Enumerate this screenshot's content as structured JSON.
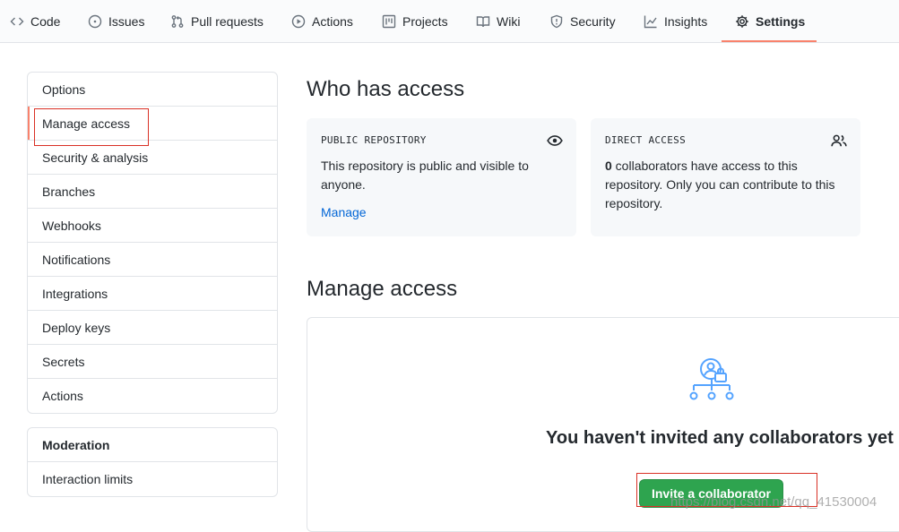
{
  "repo_nav": {
    "tabs": [
      {
        "label": "Code",
        "icon": "code-icon"
      },
      {
        "label": "Issues",
        "icon": "issue-icon"
      },
      {
        "label": "Pull requests",
        "icon": "pull-request-icon"
      },
      {
        "label": "Actions",
        "icon": "play-icon"
      },
      {
        "label": "Projects",
        "icon": "project-icon"
      },
      {
        "label": "Wiki",
        "icon": "book-icon"
      },
      {
        "label": "Security",
        "icon": "shield-icon"
      },
      {
        "label": "Insights",
        "icon": "graph-icon"
      },
      {
        "label": "Settings",
        "icon": "gear-icon"
      }
    ],
    "active": "Settings"
  },
  "sidebar": {
    "items": [
      "Options",
      "Manage access",
      "Security & analysis",
      "Branches",
      "Webhooks",
      "Notifications",
      "Integrations",
      "Deploy keys",
      "Secrets",
      "Actions"
    ],
    "selected": "Manage access",
    "moderation": {
      "heading": "Moderation",
      "items": [
        "Interaction limits"
      ]
    }
  },
  "who_has_access": {
    "title": "Who has access",
    "public_card": {
      "label": "PUBLIC REPOSITORY",
      "text_line1": "This repository is public and visible to",
      "text_line2": "anyone.",
      "link": "Manage",
      "icon": "eye-icon"
    },
    "direct_card": {
      "label": "DIRECT ACCESS",
      "count": "0",
      "text_line1": " collaborators have access to this",
      "text_line2": "repository. Only you can contribute to this",
      "text_line3": "repository.",
      "icon": "people-icon"
    }
  },
  "manage_access": {
    "title": "Manage access",
    "empty_title": "You haven't invited any collaborators yet",
    "invite_button": "Invite a collaborator",
    "illustration_icon": "collaborators-lock-icon"
  },
  "watermark": "https://blog.csdn.net/qq_41530004",
  "colors": {
    "accent_underline": "#f9826c",
    "link": "#0366d6",
    "primary_button": "#2ea44f",
    "annotation_box": "#d93025",
    "illustration": "#54a3ff"
  }
}
